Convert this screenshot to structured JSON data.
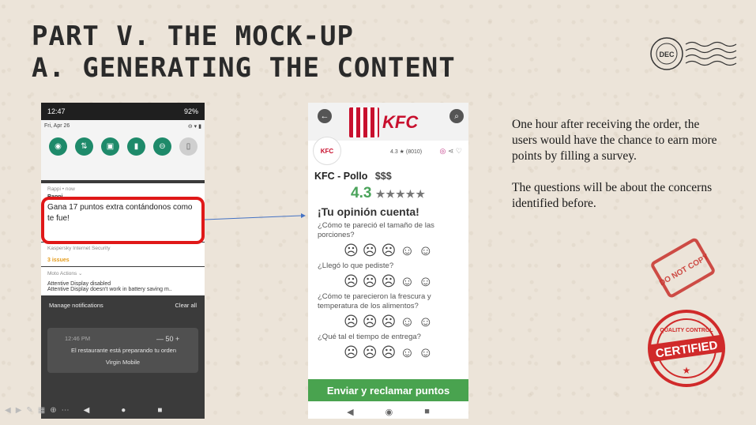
{
  "title": {
    "line1": "PART V. THE MOCK-UP",
    "line2": "A. GENERATING THE CONTENT"
  },
  "left_phone": {
    "status_time": "12:47",
    "status_battery": "92%",
    "date": "Fri, Apr 26",
    "rappi_app": "Rappi • now",
    "rappi_title": "Rappi",
    "rappi_body": "Gana 17 puntos extra contándonos como te fue!",
    "kaspersky_app": "Kaspersky Internet Security",
    "kaspersky_issue": "3 issues",
    "moto_app": "Moto Actions ⌄",
    "moto_title": "Attentive Display disabled",
    "moto_body": "Attentive Display doesn't work in battery saving m..",
    "manage": "Manage notifications",
    "clear_all": "Clear all",
    "stepper_value": "50",
    "card_time": "12:46 PM",
    "card_body": "El restaurante está preparando tu orden",
    "carrier": "Virgin Mobile"
  },
  "right_phone": {
    "brand": "KFC",
    "avatar_label": "KFC",
    "rating_small": "4.3 ★ (8010)",
    "restaurant": "KFC - Pollo",
    "price": "$$$",
    "rating_big": "4.3",
    "stars": "★★★★★",
    "survey_title": "¡Tu opinión cuenta!",
    "questions": [
      "¿Cómo te pareció el tamaño de las porciones?",
      "¿Llegó lo que pediste?",
      "¿Cómo te parecieron la frescura y temperatura de los alimentos?",
      "¿Qué tal el tiempo de entrega?"
    ],
    "faces": "☹ ☹ ☹ ☺ ☺",
    "cta": "Enviar y reclamar puntos"
  },
  "description": {
    "p1": "One hour after receiving the order, the users would have the chance to earn more points by filling  a survey.",
    "p2": "The questions will be about the concerns identified before."
  },
  "stamps": {
    "postmark": "DEC",
    "do_not_copy": "DO NOT COPY",
    "certified": "CERTIFIED",
    "quality": "QUALITY CONTROL"
  },
  "colors": {
    "highlight": "#e01818",
    "kfc_red": "#c8102e",
    "green": "#49a34f"
  }
}
